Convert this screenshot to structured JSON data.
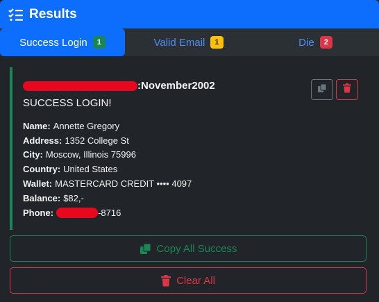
{
  "header": {
    "title": "Results",
    "icon": "list-check-icon"
  },
  "tabs": [
    {
      "label": "Success Login",
      "count": "1",
      "active": true
    },
    {
      "label": "Valid Email",
      "count": "1"
    },
    {
      "label": "Die",
      "count": "2"
    }
  ],
  "result": {
    "title_suffix": ":November2002",
    "status": "SUCCESS LOGIN!",
    "fields": [
      {
        "label": "Name:",
        "value": "Annette Gregory"
      },
      {
        "label": "Address:",
        "value": "1352 College St"
      },
      {
        "label": "City:",
        "value": "Moscow, Illinois 75996"
      },
      {
        "label": "Country:",
        "value": "United States"
      },
      {
        "label": "Wallet:",
        "value": "MASTERCARD CREDIT •••• 4097"
      },
      {
        "label": "Balance:",
        "value": "$82,-"
      },
      {
        "label": "Phone:",
        "value": "-8716"
      }
    ]
  },
  "actions": {
    "copy_all": "Copy All Success",
    "clear_all": "Clear All"
  },
  "colors": {
    "primary": "#0d6efd",
    "success": "#198754",
    "warning": "#ffc107",
    "danger": "#dc3545",
    "background": "#212529"
  }
}
